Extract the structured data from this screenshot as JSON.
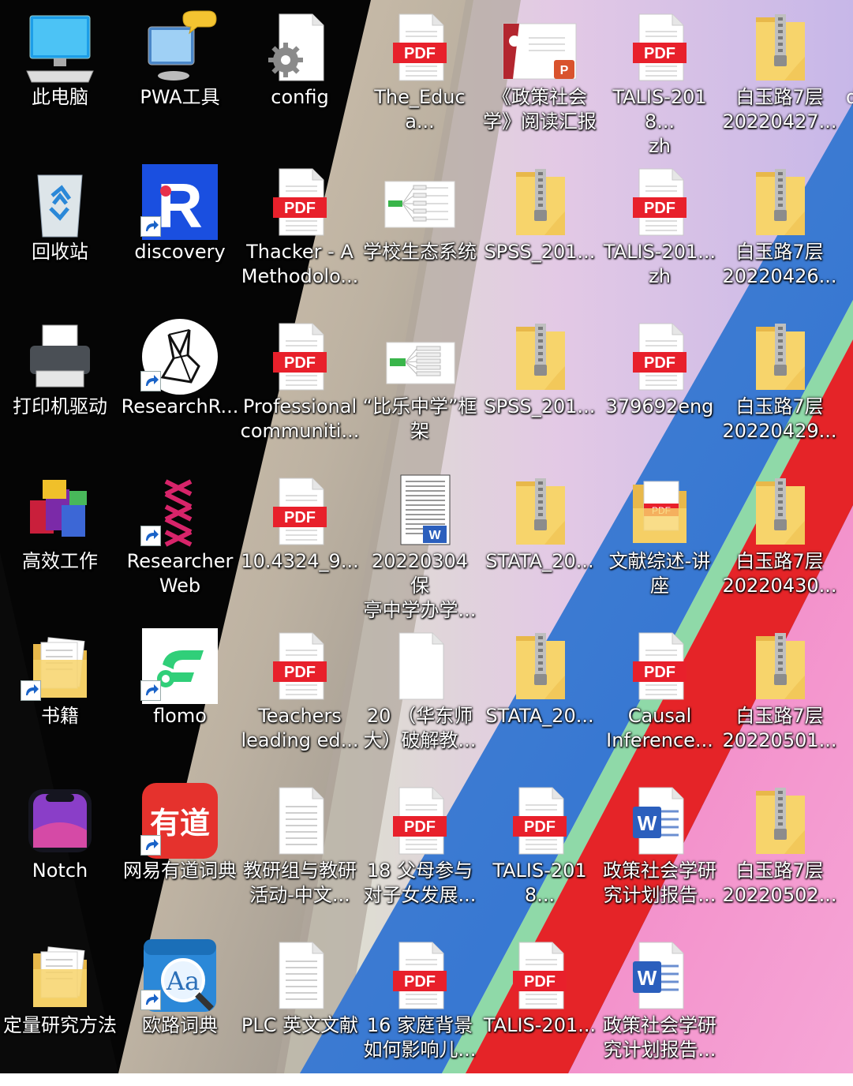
{
  "desktop": {
    "icons": [
      {
        "label": "此电脑",
        "type": "computer",
        "col": 0,
        "row": 0
      },
      {
        "label": "回收站",
        "type": "recycle",
        "col": 0,
        "row": 1
      },
      {
        "label": "打印机驱动",
        "type": "printer",
        "col": 0,
        "row": 2
      },
      {
        "label": "高效工作",
        "type": "winrar",
        "col": 0,
        "row": 3
      },
      {
        "label": "书籍",
        "type": "folder-docs",
        "col": 0,
        "row": 4,
        "shortcut": true
      },
      {
        "label": "Notch",
        "type": "notch",
        "col": 0,
        "row": 5
      },
      {
        "label": "定量研究方法",
        "type": "folder-docs",
        "col": 0,
        "row": 6
      },
      {
        "label": "PWA工具",
        "type": "pwa",
        "col": 1,
        "row": 0
      },
      {
        "label": "discovery",
        "type": "app-r",
        "col": 1,
        "row": 1,
        "shortcut": true
      },
      {
        "label": "ResearchR...",
        "type": "app-rabbit",
        "col": 1,
        "row": 2,
        "shortcut": true
      },
      {
        "label": "Researcher\nWeb",
        "type": "app-researcher",
        "col": 1,
        "row": 3,
        "shortcut": true
      },
      {
        "label": "flomo",
        "type": "app-flomo",
        "col": 1,
        "row": 4,
        "shortcut": true
      },
      {
        "label": "网易有道词典",
        "type": "app-youdao",
        "col": 1,
        "row": 5,
        "shortcut": true
      },
      {
        "label": "欧路词典",
        "type": "app-eudic",
        "col": 1,
        "row": 6,
        "shortcut": true
      },
      {
        "label": "config",
        "type": "config",
        "col": 2,
        "row": 0
      },
      {
        "label": "Thacker - A\nMethodolo...",
        "type": "pdf",
        "col": 2,
        "row": 1
      },
      {
        "label": "Professional\ncommuniti...",
        "type": "pdf",
        "col": 2,
        "row": 2
      },
      {
        "label": "10.4324_9...",
        "type": "pdf",
        "col": 2,
        "row": 3
      },
      {
        "label": "Teachers\nleading ed...",
        "type": "pdf",
        "col": 2,
        "row": 4
      },
      {
        "label": "教研组与教研\n活动-中文...",
        "type": "doc-blank",
        "col": 2,
        "row": 5
      },
      {
        "label": "PLC 英文文献",
        "type": "doc-blank",
        "col": 2,
        "row": 6
      },
      {
        "label": "The_Educa...",
        "type": "pdf",
        "col": 3,
        "row": 0
      },
      {
        "label": "学校生态系统",
        "type": "mindmap",
        "col": 3,
        "row": 1
      },
      {
        "label": "“比乐中学”框\n架",
        "type": "mindmap2",
        "col": 3,
        "row": 2
      },
      {
        "label": "20220304 保\n亭中学办学...",
        "type": "word-thumb",
        "col": 3,
        "row": 3
      },
      {
        "label": "20 （华东师\n大）破解教...",
        "type": "blank-file",
        "col": 3,
        "row": 4
      },
      {
        "label": "18 父母参与\n对子女发展...",
        "type": "pdf",
        "col": 3,
        "row": 5
      },
      {
        "label": "16 家庭背景\n如何影响儿...",
        "type": "pdf",
        "col": 3,
        "row": 6
      },
      {
        "label": "《政策社会\n学》阅读汇报",
        "type": "ppt-thumb",
        "col": 4,
        "row": 0
      },
      {
        "label": "SPSS_201...",
        "type": "zip",
        "col": 4,
        "row": 1
      },
      {
        "label": "SPSS_201...",
        "type": "zip",
        "col": 4,
        "row": 2
      },
      {
        "label": "STATA_20...",
        "type": "zip",
        "col": 4,
        "row": 3
      },
      {
        "label": "STATA_20...",
        "type": "zip",
        "col": 4,
        "row": 4
      },
      {
        "label": "TALIS-2018...",
        "type": "pdf",
        "col": 4,
        "row": 5
      },
      {
        "label": "TALIS-201...",
        "type": "pdf",
        "col": 4,
        "row": 6
      },
      {
        "label": "TALIS-2018...\nzh",
        "type": "pdf",
        "col": 5,
        "row": 0
      },
      {
        "label": "TALIS-201...\nzh",
        "type": "pdf",
        "col": 5,
        "row": 1
      },
      {
        "label": "379692eng",
        "type": "pdf",
        "col": 5,
        "row": 2
      },
      {
        "label": "文献综述-讲\n座",
        "type": "folder-pdf",
        "col": 5,
        "row": 3
      },
      {
        "label": "Causal\nInference...",
        "type": "pdf",
        "col": 5,
        "row": 4
      },
      {
        "label": "政策社会学研\n究计划报告...",
        "type": "word",
        "col": 5,
        "row": 5
      },
      {
        "label": "政策社会学研\n究计划报告...",
        "type": "word",
        "col": 5,
        "row": 6
      },
      {
        "label": "白玉路7层\n20220427...",
        "type": "zip",
        "col": 6,
        "row": 0
      },
      {
        "label": "白玉路7层\n20220426...",
        "type": "zip",
        "col": 6,
        "row": 1
      },
      {
        "label": "白玉路7层\n20220429...",
        "type": "zip",
        "col": 6,
        "row": 2
      },
      {
        "label": "白玉路7层\n20220430...",
        "type": "zip",
        "col": 6,
        "row": 3
      },
      {
        "label": "白玉路7层\n20220501...",
        "type": "zip",
        "col": 6,
        "row": 4
      },
      {
        "label": "白玉路7层\n20220502...",
        "type": "zip",
        "col": 6,
        "row": 5
      }
    ],
    "partial_label": "d"
  },
  "colors": {
    "pdf_red": "#e8202b",
    "folder_yellow": "#f7d46b",
    "word_blue": "#2b5fbd",
    "youdao_red": "#e5322d",
    "discovery_blue": "#1a4fe0"
  }
}
